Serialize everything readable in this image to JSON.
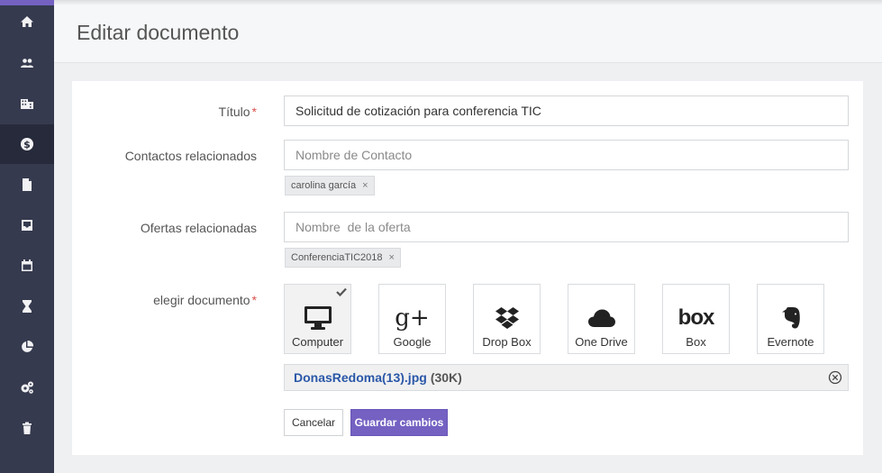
{
  "page": {
    "title": "Editar documento"
  },
  "colors": {
    "accent": "#7461c2",
    "sidebar": "#363a4e",
    "sidebar_active": "#272a3a",
    "link": "#2a57a8",
    "required": "#d9534f"
  },
  "sidebar": {
    "items": [
      {
        "icon": "home-icon"
      },
      {
        "icon": "users-icon"
      },
      {
        "icon": "building-icon"
      },
      {
        "icon": "dollar-icon",
        "active": true
      },
      {
        "icon": "document-icon"
      },
      {
        "icon": "inbox-icon"
      },
      {
        "icon": "calendar-icon"
      },
      {
        "icon": "hourglass-icon"
      },
      {
        "icon": "pie-chart-icon"
      },
      {
        "icon": "gears-icon"
      },
      {
        "icon": "trash-icon"
      }
    ]
  },
  "form": {
    "titulo": {
      "label": "Título",
      "required_mark": "*",
      "value": "Solicitud de cotización para conferencia TIC"
    },
    "contactos": {
      "label": "Contactos relacionados",
      "placeholder": "Nombre de Contacto",
      "tags": [
        "carolina garcía"
      ]
    },
    "ofertas": {
      "label": "Ofertas relacionadas",
      "placeholder": "Nombre  de la oferta",
      "tags": [
        "ConferenciaTIC2018"
      ]
    },
    "documento": {
      "label": "elegir documento",
      "required_mark": "*",
      "sources": [
        {
          "name": "Computer",
          "icon": "monitor-icon",
          "selected": true
        },
        {
          "name": "Google",
          "icon": "google-plus-icon",
          "logo_text": "g+"
        },
        {
          "name": "Drop Box",
          "icon": "dropbox-icon"
        },
        {
          "name": "One Drive",
          "icon": "cloud-icon"
        },
        {
          "name": "Box",
          "icon": "box-icon",
          "logo_text": "box"
        },
        {
          "name": "Evernote",
          "icon": "evernote-icon"
        }
      ],
      "file": {
        "name": "DonasRedoma(13).jpg",
        "size": "(30K)"
      }
    },
    "cancel_label": "Cancelar",
    "save_label": "Guardar cambios",
    "tag_remove": "×"
  }
}
